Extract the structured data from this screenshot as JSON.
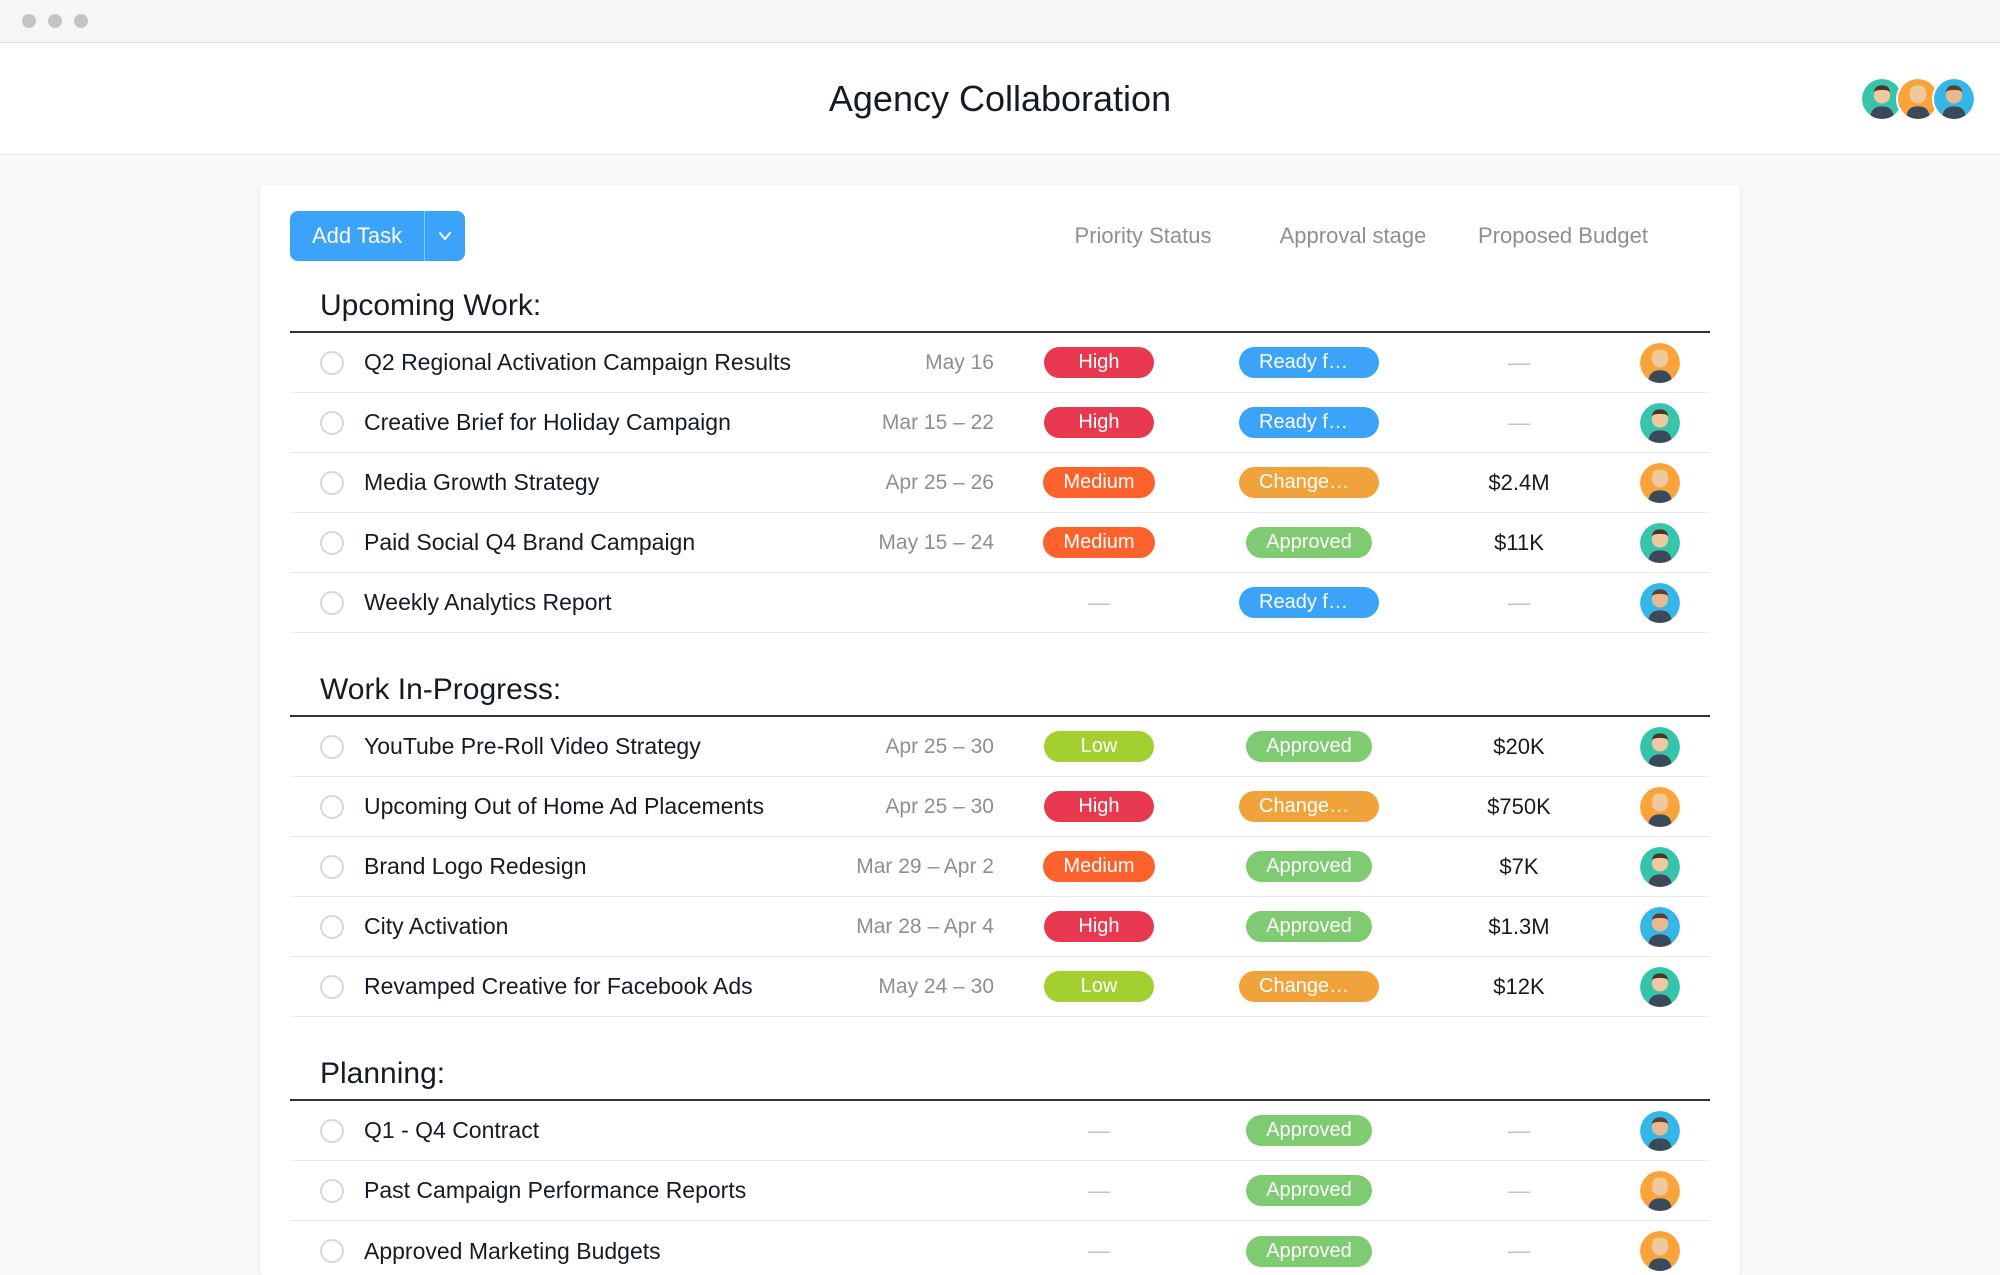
{
  "header": {
    "title": "Agency Collaboration"
  },
  "toolbar": {
    "add_label": "Add Task"
  },
  "columns": {
    "priority": "Priority Status",
    "approval": "Approval stage",
    "budget": "Proposed Budget"
  },
  "avatars": [
    "teal",
    "orange",
    "blue"
  ],
  "sections": [
    {
      "title": "Upcoming Work:",
      "tasks": [
        {
          "name": "Q2 Regional Activation Campaign Results",
          "date": "May 16",
          "priority": "High",
          "priority_class": "high",
          "approval": "Ready fo…",
          "approval_class": "ready",
          "budget": "",
          "avatar": "orange"
        },
        {
          "name": "Creative Brief for Holiday Campaign",
          "date": "Mar 15 – 22",
          "priority": "High",
          "priority_class": "high",
          "approval": "Ready fo…",
          "approval_class": "ready",
          "budget": "",
          "avatar": "teal"
        },
        {
          "name": "Media Growth Strategy",
          "date": "Apr 25 – 26",
          "priority": "Medium",
          "priority_class": "medium",
          "approval": "Changes…",
          "approval_class": "changes",
          "budget": "$2.4M",
          "avatar": "orange"
        },
        {
          "name": "Paid Social Q4 Brand Campaign",
          "date": "May 15 – 24",
          "priority": "Medium",
          "priority_class": "medium",
          "approval": "Approved",
          "approval_class": "approved",
          "budget": "$11K",
          "avatar": "teal"
        },
        {
          "name": "Weekly Analytics Report",
          "date": "",
          "priority": "",
          "priority_class": "",
          "approval": "Ready fo…",
          "approval_class": "ready",
          "budget": "",
          "avatar": "blue"
        }
      ]
    },
    {
      "title": "Work In-Progress:",
      "tasks": [
        {
          "name": "YouTube Pre-Roll Video Strategy",
          "date": "Apr 25 – 30",
          "priority": "Low",
          "priority_class": "low",
          "approval": "Approved",
          "approval_class": "approved",
          "budget": "$20K",
          "avatar": "teal"
        },
        {
          "name": "Upcoming Out of Home Ad Placements",
          "date": "Apr 25 – 30",
          "priority": "High",
          "priority_class": "high",
          "approval": "Changes…",
          "approval_class": "changes",
          "budget": "$750K",
          "avatar": "orange"
        },
        {
          "name": "Brand Logo Redesign",
          "date": "Mar 29 – Apr 2",
          "priority": "Medium",
          "priority_class": "medium",
          "approval": "Approved",
          "approval_class": "approved",
          "budget": "$7K",
          "avatar": "teal"
        },
        {
          "name": "City Activation",
          "date": "Mar 28 – Apr 4",
          "priority": "High",
          "priority_class": "high",
          "approval": "Approved",
          "approval_class": "approved",
          "budget": "$1.3M",
          "avatar": "blue"
        },
        {
          "name": "Revamped Creative for Facebook Ads",
          "date": "May 24 – 30",
          "priority": "Low",
          "priority_class": "low",
          "approval": "Changes…",
          "approval_class": "changes",
          "budget": "$12K",
          "avatar": "teal"
        }
      ]
    },
    {
      "title": "Planning:",
      "tasks": [
        {
          "name": "Q1 - Q4 Contract",
          "date": "",
          "priority": "",
          "priority_class": "",
          "approval": "Approved",
          "approval_class": "approved",
          "budget": "",
          "avatar": "blue"
        },
        {
          "name": "Past Campaign Performance Reports",
          "date": "",
          "priority": "",
          "priority_class": "",
          "approval": "Approved",
          "approval_class": "approved",
          "budget": "",
          "avatar": "orange"
        },
        {
          "name": "Approved Marketing Budgets",
          "date": "",
          "priority": "",
          "priority_class": "",
          "approval": "Approved",
          "approval_class": "approved",
          "budget": "",
          "avatar": "orange"
        }
      ]
    }
  ],
  "avatar_colors": {
    "teal": {
      "bg": "#36c5ab",
      "hair": "#4a3728",
      "skin": "#f0c8a0"
    },
    "orange": {
      "bg": "#f9a33a",
      "hair": "#e8d088",
      "skin": "#f0c8a0"
    },
    "blue": {
      "bg": "#35b6e8",
      "hair": "#5a4030",
      "skin": "#e8b890"
    }
  }
}
